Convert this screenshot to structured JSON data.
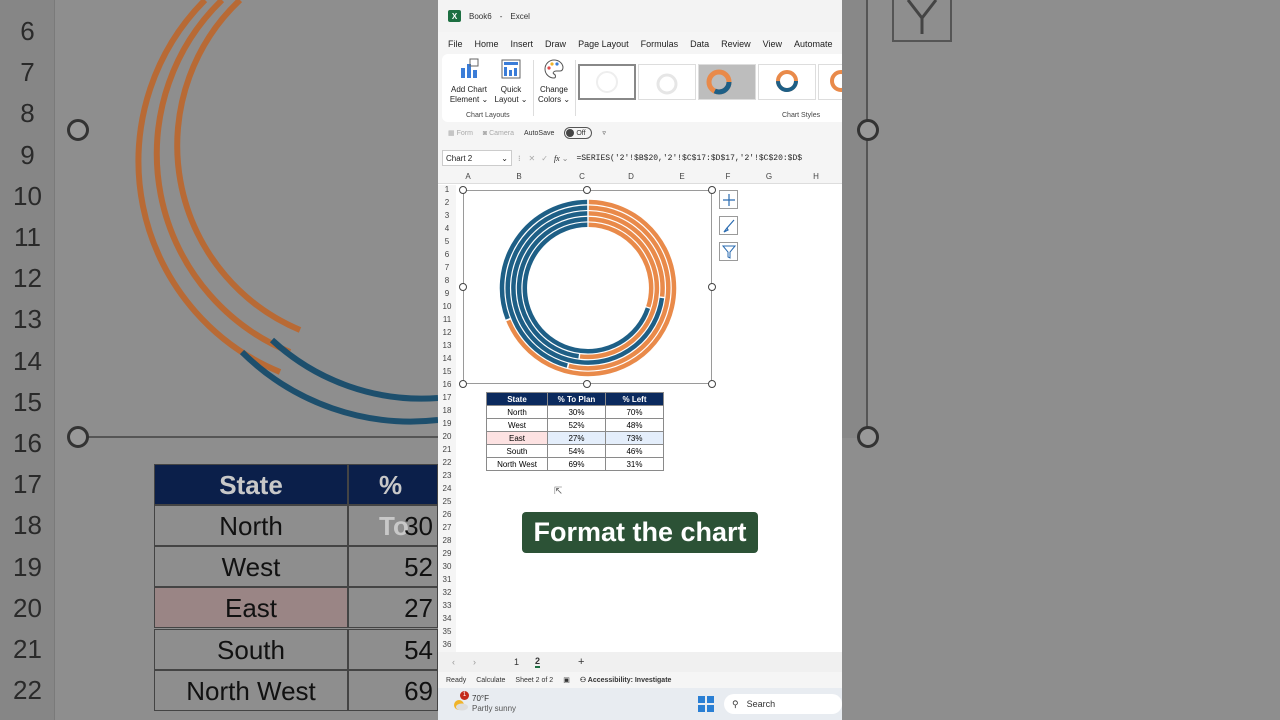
{
  "window": {
    "title": "Book6",
    "app": "Excel",
    "separator": "-"
  },
  "menu": [
    "File",
    "Home",
    "Insert",
    "Draw",
    "Page Layout",
    "Formulas",
    "Data",
    "Review",
    "View",
    "Automate"
  ],
  "ribbon": {
    "add_chart_element": "Add Chart Element",
    "add_chart_line1": "Add Chart",
    "add_chart_line2": "Element",
    "quick_layout_line1": "Quick",
    "quick_layout_line2": "Layout",
    "change_colors_line1": "Change",
    "change_colors_line2": "Colors",
    "group_layouts": "Chart Layouts",
    "group_styles": "Chart Styles"
  },
  "qat": {
    "form": "Form",
    "camera": "Camera",
    "autosave": "AutoSave",
    "autosave_state": "Off"
  },
  "formula_bar": {
    "name_box": "Chart 2",
    "fx": "fx",
    "formula": "=SERIES('2'!$B$20,'2'!$C$17:$D$17,'2'!$C$20:$D$"
  },
  "columns": [
    "A",
    "B",
    "C",
    "D",
    "E",
    "F",
    "G",
    "H"
  ],
  "rows": [
    "1",
    "2",
    "3",
    "4",
    "5",
    "6",
    "7",
    "8",
    "9",
    "10",
    "11",
    "12",
    "13",
    "14",
    "15",
    "16",
    "17",
    "18",
    "19",
    "20",
    "21",
    "22",
    "23",
    "24",
    "25",
    "26",
    "27",
    "28",
    "29",
    "30",
    "31",
    "32",
    "33",
    "34",
    "35",
    "36"
  ],
  "table": {
    "headers": [
      "State",
      "% To Plan",
      "% Left"
    ],
    "rows": [
      [
        "North",
        "30%",
        "70%"
      ],
      [
        "West",
        "52%",
        "48%"
      ],
      [
        "East",
        "27%",
        "73%"
      ],
      [
        "South",
        "54%",
        "46%"
      ],
      [
        "North West",
        "69%",
        "31%"
      ]
    ],
    "selected_row": 2
  },
  "chart_data": {
    "type": "doughnut",
    "categories": [
      "% To Plan",
      "% Left"
    ],
    "series": [
      {
        "values": [
          30,
          70
        ]
      },
      {
        "values": [
          52,
          48
        ]
      },
      {
        "values": [
          27,
          73
        ]
      },
      {
        "values": [
          54,
          46
        ]
      },
      {
        "values": [
          69,
          31
        ]
      }
    ],
    "colors": [
      "#e98a4a",
      "#1e5f86"
    ]
  },
  "caption": "Format the chart",
  "sheets": {
    "tabs": [
      "1",
      "2"
    ],
    "active": "2",
    "add": "+"
  },
  "status": {
    "ready": "Ready",
    "calculate": "Calculate",
    "sheet_info": "Sheet 2 of 2",
    "accessibility": "Accessibility: Investigate"
  },
  "taskbar": {
    "temp": "70°F",
    "weather": "Partly sunny",
    "search": "Search",
    "badge": "1"
  },
  "backdrop": {
    "rownums": [
      "6",
      "7",
      "8",
      "9",
      "10",
      "11",
      "12",
      "13",
      "14",
      "15",
      "16",
      "17",
      "18",
      "19",
      "20",
      "21",
      "22"
    ],
    "header_state": "State",
    "header_plan": "% To",
    "states": [
      "North",
      "West",
      "East",
      "South",
      "North West"
    ],
    "partial_values": [
      "30",
      "52",
      "27",
      "54",
      "69"
    ]
  }
}
